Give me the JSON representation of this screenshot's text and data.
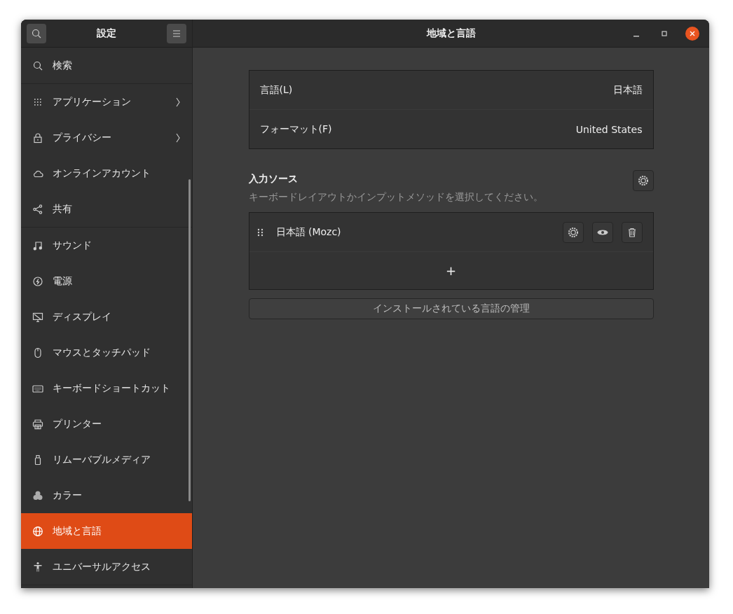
{
  "sidebar": {
    "title": "設定",
    "sections": [
      {
        "items": [
          {
            "label": "検索",
            "has_submenu": false,
            "selected": false
          }
        ]
      },
      {
        "items": [
          {
            "label": "アプリケーション",
            "has_submenu": true,
            "selected": false
          },
          {
            "label": "プライバシー",
            "has_submenu": true,
            "selected": false
          },
          {
            "label": "オンラインアカウント",
            "has_submenu": false,
            "selected": false
          },
          {
            "label": "共有",
            "has_submenu": false,
            "selected": false
          }
        ]
      },
      {
        "items": [
          {
            "label": "サウンド",
            "has_submenu": false,
            "selected": false
          },
          {
            "label": "電源",
            "has_submenu": false,
            "selected": false
          },
          {
            "label": "ディスプレイ",
            "has_submenu": false,
            "selected": false
          },
          {
            "label": "マウスとタッチパッド",
            "has_submenu": false,
            "selected": false
          },
          {
            "label": "キーボードショートカット",
            "has_submenu": false,
            "selected": false
          },
          {
            "label": "プリンター",
            "has_submenu": false,
            "selected": false
          },
          {
            "label": "リムーバブルメディア",
            "has_submenu": false,
            "selected": false
          },
          {
            "label": "カラー",
            "has_submenu": false,
            "selected": false
          },
          {
            "label": "地域と言語",
            "has_submenu": false,
            "selected": true
          },
          {
            "label": "ユニバーサルアクセス",
            "has_submenu": false,
            "selected": false
          }
        ]
      }
    ]
  },
  "window": {
    "title": "地域と言語"
  },
  "settings": [
    {
      "label": "言語(L)",
      "value": "日本語"
    },
    {
      "label": "フォーマット(F)",
      "value": "United States"
    }
  ],
  "input_sources": {
    "heading": "入力ソース",
    "description": "キーボードレイアウトかインプットメソッドを選択してください。",
    "sources": [
      {
        "name": "日本語 (Mozc)"
      }
    ],
    "add_label": "+"
  },
  "manage_button": "インストールされている言語の管理"
}
